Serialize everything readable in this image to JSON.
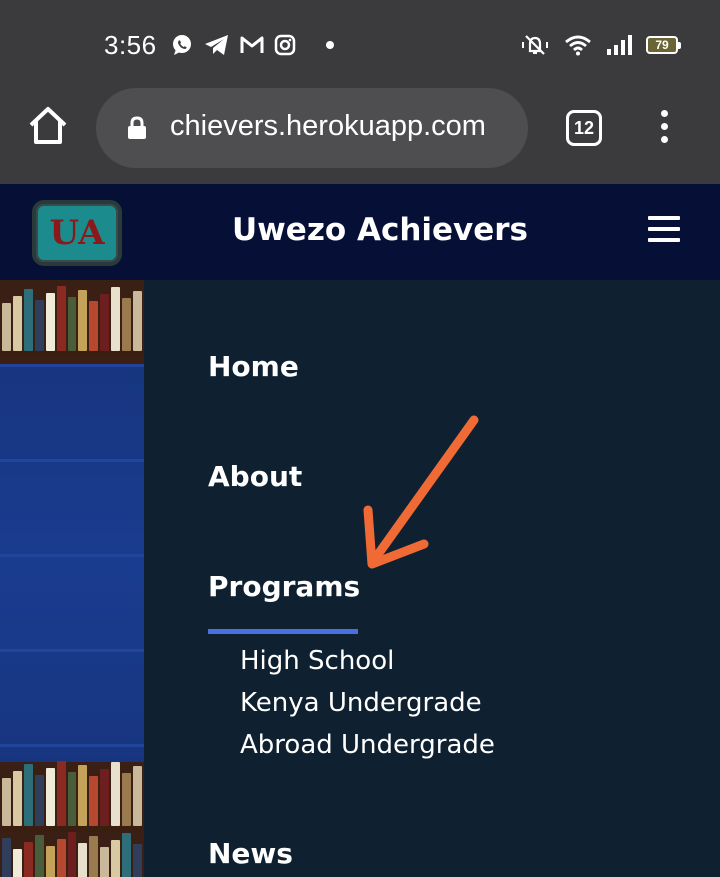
{
  "status_bar": {
    "time": "3:56",
    "battery": "79",
    "left_icons": [
      "whatsapp-icon",
      "telegram-icon",
      "gmail-icon",
      "instagram-icon"
    ],
    "right_icons": [
      "vibrate-mute-icon",
      "wifi-icon",
      "signal-icon",
      "battery-icon"
    ]
  },
  "browser": {
    "url": "chievers.herokuapp.com",
    "tab_count": "12"
  },
  "site": {
    "logo_text": "UA",
    "title": "Uwezo Achievers",
    "brand_color": "#060f36",
    "logo_color": "#1c8b8e"
  },
  "nav": {
    "items": [
      {
        "label": "Home"
      },
      {
        "label": "About"
      },
      {
        "label": "Programs"
      },
      {
        "label": "News"
      }
    ],
    "active_underline_color": "#4a6fe0",
    "submenu": [
      {
        "label": "High School"
      },
      {
        "label": "Kenya Undergrade"
      },
      {
        "label": "Abroad Undergrade"
      }
    ]
  },
  "annotation": {
    "arrow_color": "#f06a35"
  }
}
